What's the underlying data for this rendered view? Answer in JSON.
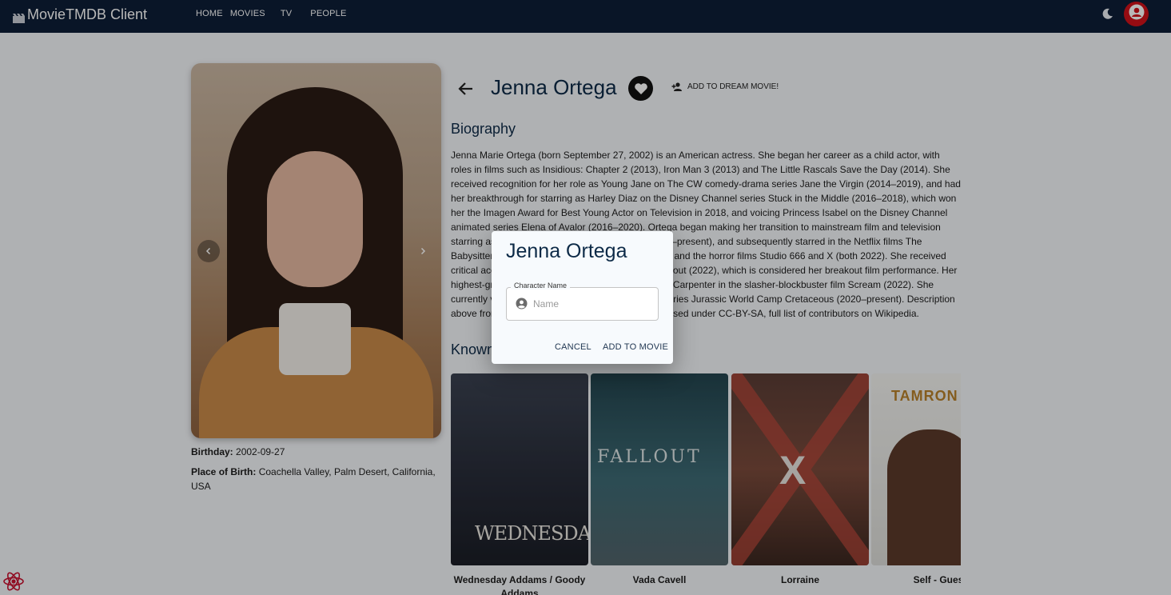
{
  "app": {
    "brand": "MovieTMDB Client",
    "nav": [
      "HOME",
      "MOVIES",
      "TV",
      "PEOPLE"
    ],
    "icons": {
      "brand": "clapperboard-icon",
      "theme": "moon-icon",
      "account": "user-avatar-icon"
    },
    "colors": {
      "appbar": "#0d1e36",
      "avatar": "#d0111a",
      "title": "#0d2a47"
    }
  },
  "person": {
    "name": "Jenna Ortega",
    "dream_button": "ADD TO DREAM MOVIE!",
    "birthday_label": "Birthday:",
    "birthday": "2002-09-27",
    "birthplace_label": "Place of Birth:",
    "birthplace": "Coachella Valley, Palm Desert, California, USA",
    "biography_title": "Biography",
    "biography": "Jenna Marie Ortega (born September 27, 2002) is an American actress. She began her career as a child actor, with roles in films such as Insidious: Chapter 2 (2013), Iron Man 3 (2013) and The Little Rascals Save the Day (2014). She received recognition for her role as Young Jane on The CW comedy-drama series Jane the Virgin (2014–2019), and had her breakthrough for starring as Harley Diaz on the Disney Channel series Stuck in the Middle (2016–2018), which won her the Imagen Award for Best Young Actor on Television in 2018, and voicing Princess Isabel on the Disney Channel animated series Elena of Avalor (2016–2020). Ortega began making her transition to mainstream film and television starring as Ellie Alves in the Netflix series You (2018–present), and subsequently starred in the Netflix films The Babysitter: Killer Queen (2020) and Yes Day (2021), and the horror films Studio 666 and X (both 2022). She received critical acclaim for her role in the drama film The Fallout (2022), which is considered her breakout film performance. Her highest-grossing release came with her role as Tara Carpenter in the slasher-blockbuster film Scream (2022). She currently voices Brooklynn in the Netflix animated series Jurassic World Camp Cretaceous (2020–present). Description above from the Wikipedia article Jenna Ortega, licensed under CC-BY-SA, full list of contributors on Wikipedia.",
    "known_for_title": "Known For",
    "known_for": [
      {
        "poster_text": "WEDNESDAY",
        "character": "Wednesday Addams / Goody Addams"
      },
      {
        "poster_text": "FALLOUT",
        "character": "Vada Cavell"
      },
      {
        "poster_text": "X",
        "character": "Lorraine"
      },
      {
        "poster_text": "TAMRON",
        "character": "Self - Guest"
      }
    ]
  },
  "dialog": {
    "title": "Jenna Ortega",
    "field_label": "Character Name",
    "field_placeholder": "Name",
    "field_value": "",
    "cancel": "CANCEL",
    "confirm": "ADD TO MOVIE"
  }
}
